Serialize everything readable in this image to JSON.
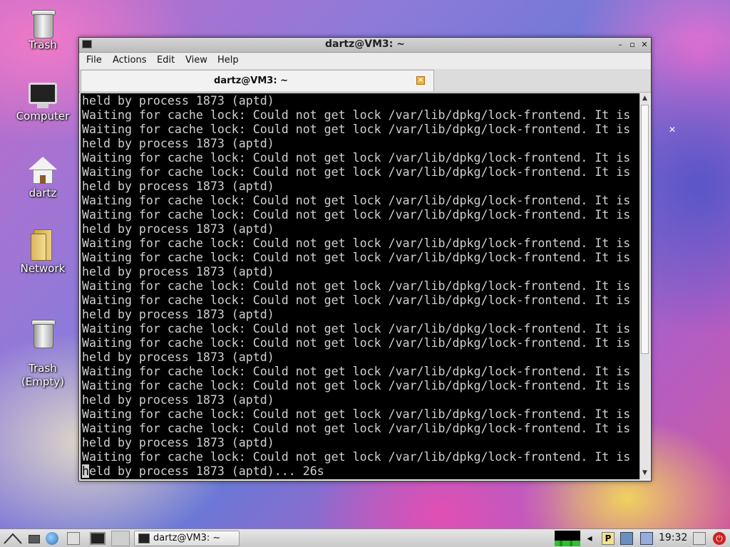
{
  "desktop": {
    "icons": [
      {
        "label": "Trash"
      },
      {
        "label": "Computer"
      },
      {
        "label": "dartz"
      },
      {
        "label": "Network"
      },
      {
        "label": "Trash\n(Empty)"
      }
    ]
  },
  "window": {
    "title": "dartz@VM3: ~",
    "menu": [
      "File",
      "Actions",
      "Edit",
      "View",
      "Help"
    ],
    "tab_label": "dartz@VM3: ~",
    "terminal_lines": [
      "held by process 1873 (aptd)",
      "Waiting for cache lock: Could not get lock /var/lib/dpkg/lock-frontend. It is",
      "Waiting for cache lock: Could not get lock /var/lib/dpkg/lock-frontend. It is",
      "held by process 1873 (aptd)",
      "Waiting for cache lock: Could not get lock /var/lib/dpkg/lock-frontend. It is",
      "Waiting for cache lock: Could not get lock /var/lib/dpkg/lock-frontend. It is",
      "held by process 1873 (aptd)",
      "Waiting for cache lock: Could not get lock /var/lib/dpkg/lock-frontend. It is",
      "Waiting for cache lock: Could not get lock /var/lib/dpkg/lock-frontend. It is",
      "held by process 1873 (aptd)",
      "Waiting for cache lock: Could not get lock /var/lib/dpkg/lock-frontend. It is",
      "Waiting for cache lock: Could not get lock /var/lib/dpkg/lock-frontend. It is",
      "held by process 1873 (aptd)",
      "Waiting for cache lock: Could not get lock /var/lib/dpkg/lock-frontend. It is",
      "Waiting for cache lock: Could not get lock /var/lib/dpkg/lock-frontend. It is",
      "held by process 1873 (aptd)",
      "Waiting for cache lock: Could not get lock /var/lib/dpkg/lock-frontend. It is",
      "Waiting for cache lock: Could not get lock /var/lib/dpkg/lock-frontend. It is",
      "held by process 1873 (aptd)",
      "Waiting for cache lock: Could not get lock /var/lib/dpkg/lock-frontend. It is",
      "Waiting for cache lock: Could not get lock /var/lib/dpkg/lock-frontend. It is",
      "held by process 1873 (aptd)",
      "Waiting for cache lock: Could not get lock /var/lib/dpkg/lock-frontend. It is",
      "Waiting for cache lock: Could not get lock /var/lib/dpkg/lock-frontend. It is",
      "held by process 1873 (aptd)",
      "Waiting for cache lock: Could not get lock /var/lib/dpkg/lock-frontend. It is"
    ],
    "last_line_cursor_char": "h",
    "last_line_rest": "eld by process 1873 (aptd)... 26s"
  },
  "taskbar": {
    "task_label": "dartz@VM3: ~",
    "clock": "19:32"
  },
  "colors": {
    "terminal_bg": "#000000",
    "terminal_fg": "#d0d0d0"
  }
}
